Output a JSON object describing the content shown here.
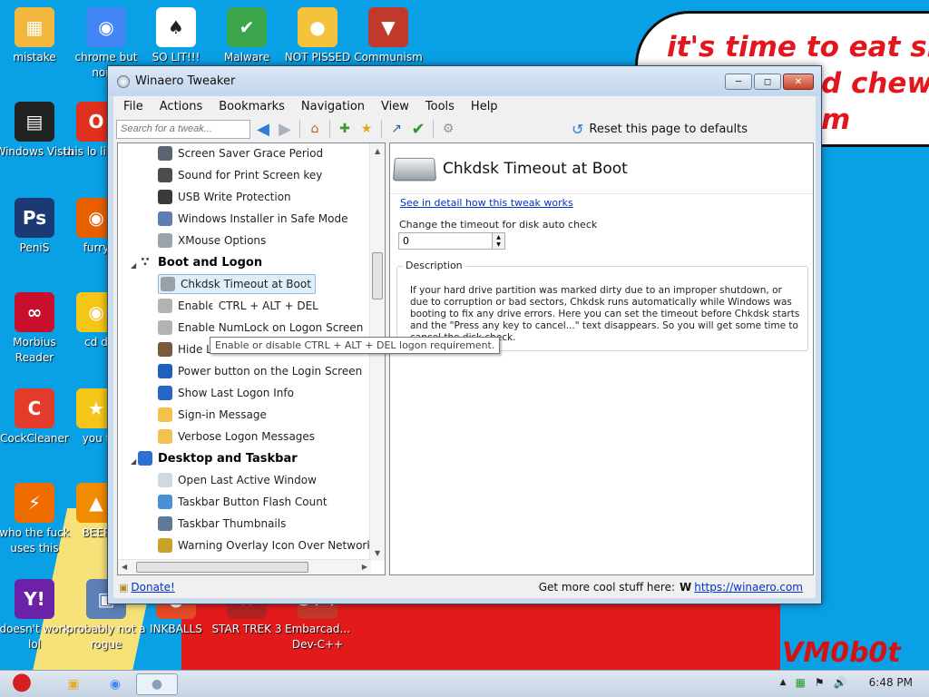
{
  "wallpaper": {
    "bubble_lines": [
      "it's time to eat shit",
      "d chew",
      "m"
    ],
    "signature": "VM0b0t"
  },
  "desktop_icons": [
    {
      "name": "mistake",
      "label": "mistake",
      "icon": "folder-icon",
      "color": "#f2b83d"
    },
    {
      "name": "chrome",
      "label": "chrome but norm",
      "icon": "chrome-icon",
      "color": "#4285f4"
    },
    {
      "name": "so-lit",
      "label": "SO LIT!!!",
      "icon": "solitaire-icon",
      "color": "#ffffff"
    },
    {
      "name": "malware",
      "label": "Malware",
      "icon": "shield-icon",
      "color": "#3aa54b"
    },
    {
      "name": "not-pissed",
      "label": "NOT PISSED",
      "icon": "pig-icon",
      "color": "#f5c33b"
    },
    {
      "name": "communism",
      "label": "Communism",
      "icon": "emblem-icon",
      "color": "#c0392b"
    },
    {
      "name": "windows-vista",
      "label": "Windows Vista",
      "icon": "recycle-bin-icon",
      "color": "#222222"
    },
    {
      "name": "this-like",
      "label": "this lo like a",
      "icon": "opera-icon",
      "color": "#e0301e"
    },
    {
      "name": "penis",
      "label": "PeniS",
      "icon": "photoshop-icon",
      "color": "#1b3a74"
    },
    {
      "name": "furry",
      "label": "furry",
      "icon": "firefox-icon",
      "color": "#e66000"
    },
    {
      "name": "morbius-reader",
      "label": "Morbius Reader",
      "icon": "acrobat-icon",
      "color": "#c8102e"
    },
    {
      "name": "cd",
      "label": "cd d",
      "icon": "disc-icon",
      "color": "#f5c518"
    },
    {
      "name": "cockcleaner",
      "label": "CockCleaner",
      "icon": "ccleaner-icon",
      "color": "#e33c2a"
    },
    {
      "name": "you",
      "label": "you t",
      "icon": "star-icon",
      "color": "#f5c518"
    },
    {
      "name": "who-the",
      "label": "who the fuck uses this",
      "icon": "winamp-icon",
      "color": "#ef6c00"
    },
    {
      "name": "beep",
      "label": "BEEP",
      "icon": "cone-icon",
      "color": "#f08c00"
    },
    {
      "name": "doesnt-work",
      "label": "doesn't work lol",
      "icon": "yahoo-icon",
      "color": "#6b21a8"
    },
    {
      "name": "not-a-rogue",
      "label": "probably not a rogue",
      "icon": "computer-icon",
      "color": "#5c7fb5"
    },
    {
      "name": "inkballs",
      "label": "INKBALLS",
      "icon": "ink-icon",
      "color": "#e34c26"
    },
    {
      "name": "star-trek",
      "label": "STAR TREK 3",
      "icon": "startrek-icon",
      "color": "#b22222"
    },
    {
      "name": "devcpp",
      "label": "Embarcad... Dev-C++",
      "icon": "cpp-icon",
      "color": "#c0392b"
    }
  ],
  "window": {
    "title": "Winaero Tweaker",
    "menu": [
      "File",
      "Actions",
      "Bookmarks",
      "Navigation",
      "View",
      "Tools",
      "Help"
    ],
    "search_placeholder": "Search for a tweak...",
    "reset_label": "Reset this page to defaults",
    "tree": {
      "items": [
        {
          "label": "Screen Saver Grace Period",
          "icon": "screensaver-icon",
          "color": "#5b6470"
        },
        {
          "label": "Sound for Print Screen key",
          "icon": "speaker-icon",
          "color": "#4d4d4d"
        },
        {
          "label": "USB Write Protection",
          "icon": "usb-icon",
          "color": "#3a3a3a"
        },
        {
          "label": "Windows Installer in Safe Mode",
          "icon": "installer-icon",
          "color": "#5a7fb0"
        },
        {
          "label": "XMouse Options",
          "icon": "mouse-icon",
          "color": "#9aa2ab"
        }
      ],
      "category_boot": "Boot and Logon",
      "boot_items": [
        {
          "label": "Chkdsk Timeout at Boot",
          "icon": "drive-icon",
          "color": "#9aa0a8"
        },
        {
          "label": "Enable CTRL + ALT + DEL",
          "icon": "keyboard-icon",
          "color": "#b3b3b3"
        },
        {
          "label": "Enable NumLock on Logon Screen",
          "icon": "keyboard-icon",
          "color": "#b3b3b3"
        },
        {
          "label": "Hide Last User Name",
          "icon": "user-icon",
          "color": "#7a5a3a"
        },
        {
          "label": "Power button on the Login Screen",
          "icon": "power-icon",
          "color": "#1f5fbf"
        },
        {
          "label": "Show Last Logon Info",
          "icon": "help-shield-icon",
          "color": "#2a64c8"
        },
        {
          "label": "Sign-in Message",
          "icon": "message-icon",
          "color": "#f2c14e"
        },
        {
          "label": "Verbose Logon Messages",
          "icon": "message-icon",
          "color": "#f2c14e"
        }
      ],
      "category_desktop": "Desktop and Taskbar",
      "desktop_items": [
        {
          "label": "Open Last Active Window",
          "icon": "window-icon",
          "color": "#cfd8e3"
        },
        {
          "label": "Taskbar Button Flash Count",
          "icon": "flash-icon",
          "color": "#4a90d9"
        },
        {
          "label": "Taskbar Thumbnails",
          "icon": "thumbnails-icon",
          "color": "#5d7a99"
        },
        {
          "label": "Warning Overlay Icon Over Network Icon in",
          "icon": "warning-icon",
          "color": "#c9a227"
        }
      ],
      "hide_last_visible": "Hide La"
    },
    "panel": {
      "title": "Chkdsk Timeout at Boot",
      "detail_link": "See in detail how this tweak works",
      "timeout_label": "Change the timeout for disk auto check",
      "timeout_value": "0",
      "description_label": "Description",
      "description_text": "If your hard drive partition was marked dirty due to an improper shutdown, or due to corruption or bad sectors, Chkdsk runs automatically while Windows was booting to fix any drive errors. Here you can set the timeout before Chkdsk starts and the \"Press any key to cancel...\" text disappears. So you will get some time to cancel the disk check."
    },
    "tooltip": "Enable or disable CTRL + ALT + DEL logon requirement.",
    "status": {
      "donate": "Donate!",
      "more_text": "Get more cool stuff here:",
      "w_glyph": "W",
      "url": "https://winaero.com"
    }
  },
  "taskbar": {
    "clock": "6:48 PM"
  }
}
